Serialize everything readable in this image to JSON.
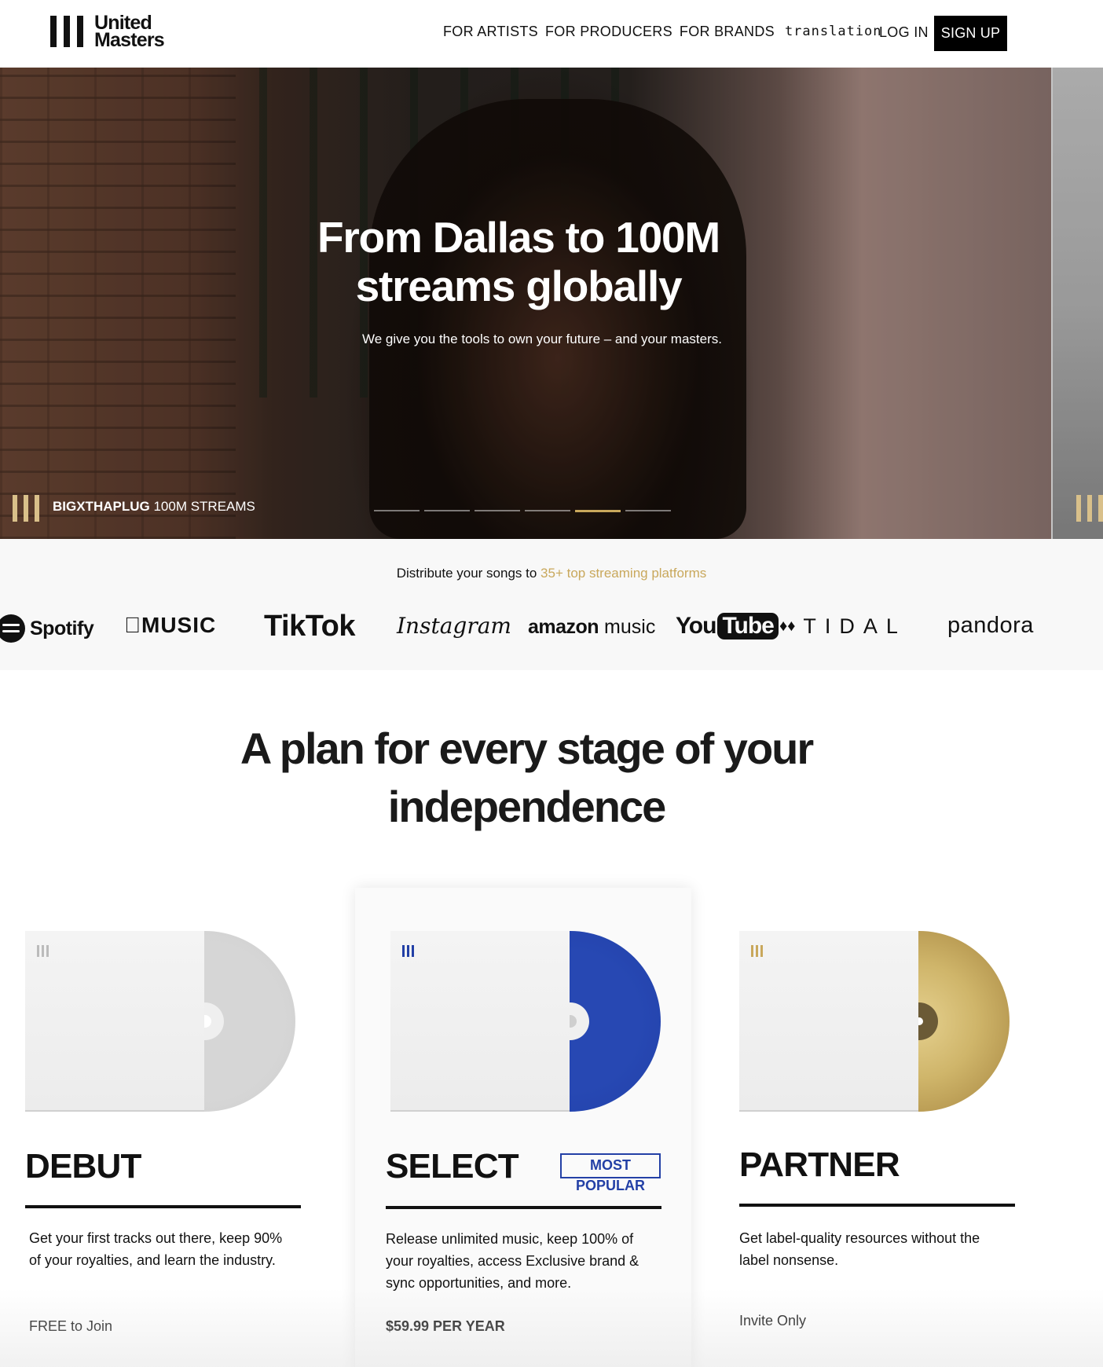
{
  "header": {
    "logo_line1": "United",
    "logo_line2": "Masters",
    "nav": [
      "FOR ARTISTS",
      "FOR PRODUCERS",
      "FOR BRANDS",
      "translation"
    ],
    "login": "LOG IN",
    "signup": "SIGN UP"
  },
  "hero": {
    "title": "From Dallas to 100M streams globally",
    "subtitle": "We give you the tools to own your future – and your masters.",
    "caption_name": "BIGXTHAPLUG",
    "caption_rest": " 100M STREAMS",
    "slides": 6,
    "active_slide": 5
  },
  "platforms": {
    "lead": "Distribute your songs to ",
    "highlight": "35+ top streaming platforms",
    "logos": {
      "spotify": "Spotify",
      "apple_music": "MUSIC",
      "tiktok": "TikTok",
      "instagram": "Instagram",
      "amazon_a": "amazon",
      "amazon_b": " music",
      "youtube_a": "You",
      "youtube_b": "Tube",
      "tidal": "TIDAL",
      "pandora": "pandora"
    }
  },
  "plans": {
    "title": "A plan for every stage of your independence",
    "debut": {
      "name": "DEBUT",
      "desc": "Get your first tracks out there, keep 90% of your royalties, and learn the industry.",
      "price": "FREE to Join"
    },
    "select": {
      "name": "SELECT",
      "badge_1": "MOST",
      "badge_2": "POPULAR",
      "desc": "Release unlimited music, keep 100% of your royalties, access Exclusive brand & sync opportunities, and more.",
      "price": "$59.99 PER YEAR"
    },
    "partner": {
      "name": "PARTNER",
      "desc": "Get label-quality resources without the label nonsense.",
      "price": "Invite Only"
    }
  },
  "colors": {
    "gold": "#c9a85c",
    "select_blue": "#2340a6",
    "black": "#000000"
  }
}
